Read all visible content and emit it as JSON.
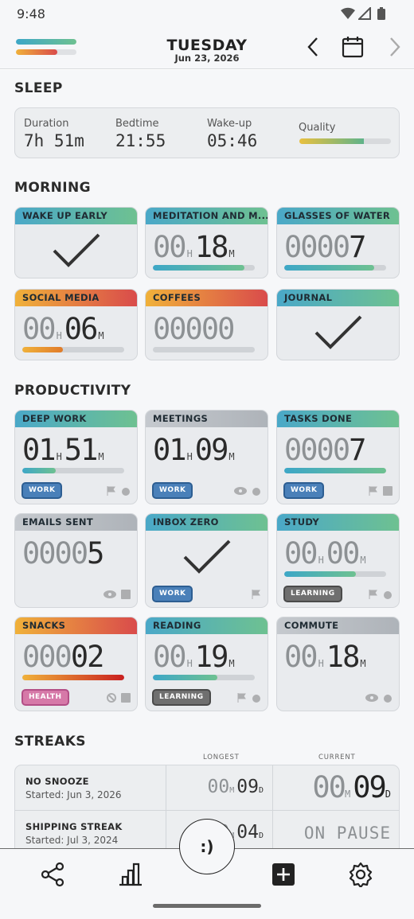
{
  "status": {
    "time": "9:48"
  },
  "header": {
    "day": "TUESDAY",
    "date": "Jun 23, 2026",
    "progress_top": 1.0,
    "progress_bottom": 0.68,
    "icons": [
      "chevron-left-icon",
      "calendar-icon",
      "chevron-right-icon"
    ]
  },
  "sleep": {
    "title": "SLEEP",
    "duration_label": "Duration",
    "duration_value": "7h 51m",
    "bedtime_label": "Bedtime",
    "bedtime_value": "21:55",
    "wakeup_label": "Wake-up",
    "wakeup_value": "05:46",
    "quality_label": "Quality",
    "quality_level": 0.7
  },
  "morning": {
    "title": "MORNING",
    "cards": [
      {
        "title": "WAKE UP EARLY",
        "kind": "check"
      },
      {
        "title": "MEDITATION AND M...",
        "hours": "00",
        "minutes": "18",
        "h": "H",
        "m": "M",
        "progress": 0.9
      },
      {
        "title": "GLASSES OF WATER",
        "count_dim": "0000",
        "count_hl": "7",
        "progress": 0.88
      },
      {
        "title": "SOCIAL MEDIA",
        "hours": "00",
        "minutes": "06",
        "h": "H",
        "m": "M",
        "progress": 0.4
      },
      {
        "title": "COFFEES",
        "count_dim": "00000",
        "count_hl": "",
        "progress": 0
      },
      {
        "title": "JOURNAL",
        "kind": "check"
      }
    ]
  },
  "productivity": {
    "title": "PRODUCTIVITY",
    "cards": [
      {
        "title": "DEEP WORK",
        "hours": "01",
        "minutes": "51",
        "h": "H",
        "m": "M",
        "progress": 0.33,
        "tag": "WORK"
      },
      {
        "title": "MEETINGS",
        "hours": "01",
        "minutes": "09",
        "h": "H",
        "m": "M",
        "tag": "WORK"
      },
      {
        "title": "TASKS DONE",
        "count_dim": "0000",
        "count_hl": "7",
        "progress": 1.0,
        "tag": "WORK"
      },
      {
        "title": "EMAILS SENT",
        "count_dim": "0000",
        "count_hl": "5"
      },
      {
        "title": "INBOX ZERO",
        "kind": "check",
        "tag": "WORK"
      },
      {
        "title": "STUDY",
        "hours": "00",
        "minutes": "00",
        "h": "H",
        "m": "M",
        "progress": 0.7,
        "tag": "LEARNING"
      },
      {
        "title": "SNACKS",
        "count_dim": "000",
        "count_hl": "02",
        "progress": 1.0,
        "tag": "HEALTH"
      },
      {
        "title": "READING",
        "hours": "00",
        "minutes": "19",
        "h": "H",
        "m": "M",
        "progress": 0.63,
        "tag": "LEARNING"
      },
      {
        "title": "COMMUTE",
        "hours": "00",
        "minutes": "18",
        "h": "H",
        "m": "M"
      }
    ]
  },
  "streaks": {
    "title": "STREAKS",
    "col_longest": "LONGEST",
    "col_current": "CURRENT",
    "rows": [
      {
        "name": "NO SNOOZE",
        "started": "Started: Jun 3, 2026",
        "longest_m": "00",
        "longest_d": "09",
        "current_m": "00",
        "current_d": "09",
        "mu": "M",
        "du": "D"
      },
      {
        "name": "SHIPPING STREAK",
        "started": "Started: Jul 3, 2024",
        "longest_m": "00",
        "longest_d": "04",
        "current": "ON PAUSE",
        "mu": "M",
        "du": "D"
      }
    ]
  },
  "fab": {
    "label": ":)"
  },
  "bottom_nav": [
    "share-icon",
    "stats-icon",
    "add-icon",
    "settings-icon"
  ]
}
